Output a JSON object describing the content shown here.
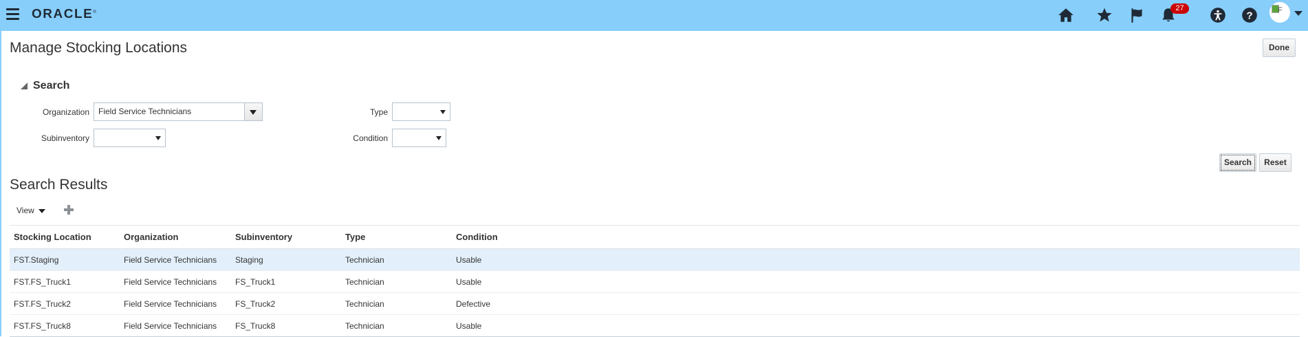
{
  "header": {
    "logo_text": "ORACLE",
    "logo_mark": "®",
    "notification_count": "27",
    "avatar_alt": "F",
    "icons": [
      "menu-icon",
      "home-icon",
      "star-icon",
      "flag-icon",
      "bell-icon",
      "accessibility-icon",
      "help-icon",
      "avatar"
    ]
  },
  "page": {
    "title": "Manage Stocking Locations",
    "done_label": "Done"
  },
  "search": {
    "section_title": "Search",
    "organization_label": "Organization",
    "organization_value": "Field Service Technicians",
    "type_label": "Type",
    "type_value": "",
    "subinventory_label": "Subinventory",
    "subinventory_value": "",
    "condition_label": "Condition",
    "condition_value": "",
    "search_button": "Search",
    "reset_button": "Reset"
  },
  "results": {
    "title": "Search Results",
    "view_label": "View",
    "columns": [
      "Stocking Location",
      "Organization",
      "Subinventory",
      "Type",
      "Condition"
    ],
    "rows": [
      [
        "FST.Staging",
        "Field Service Technicians",
        "Staging",
        "Technician",
        "Usable"
      ],
      [
        "FST.FS_Truck1",
        "Field Service Technicians",
        "FS_Truck1",
        "Technician",
        "Usable"
      ],
      [
        "FST.FS_Truck2",
        "Field Service Technicians",
        "FS_Truck2",
        "Technician",
        "Defective"
      ],
      [
        "FST.FS_Truck8",
        "Field Service Technicians",
        "FS_Truck8",
        "Technician",
        "Usable"
      ]
    ]
  },
  "colors": {
    "header_bg": "#87cefa",
    "selected_row": "#e3f0fb",
    "badge": "#cc0000"
  }
}
